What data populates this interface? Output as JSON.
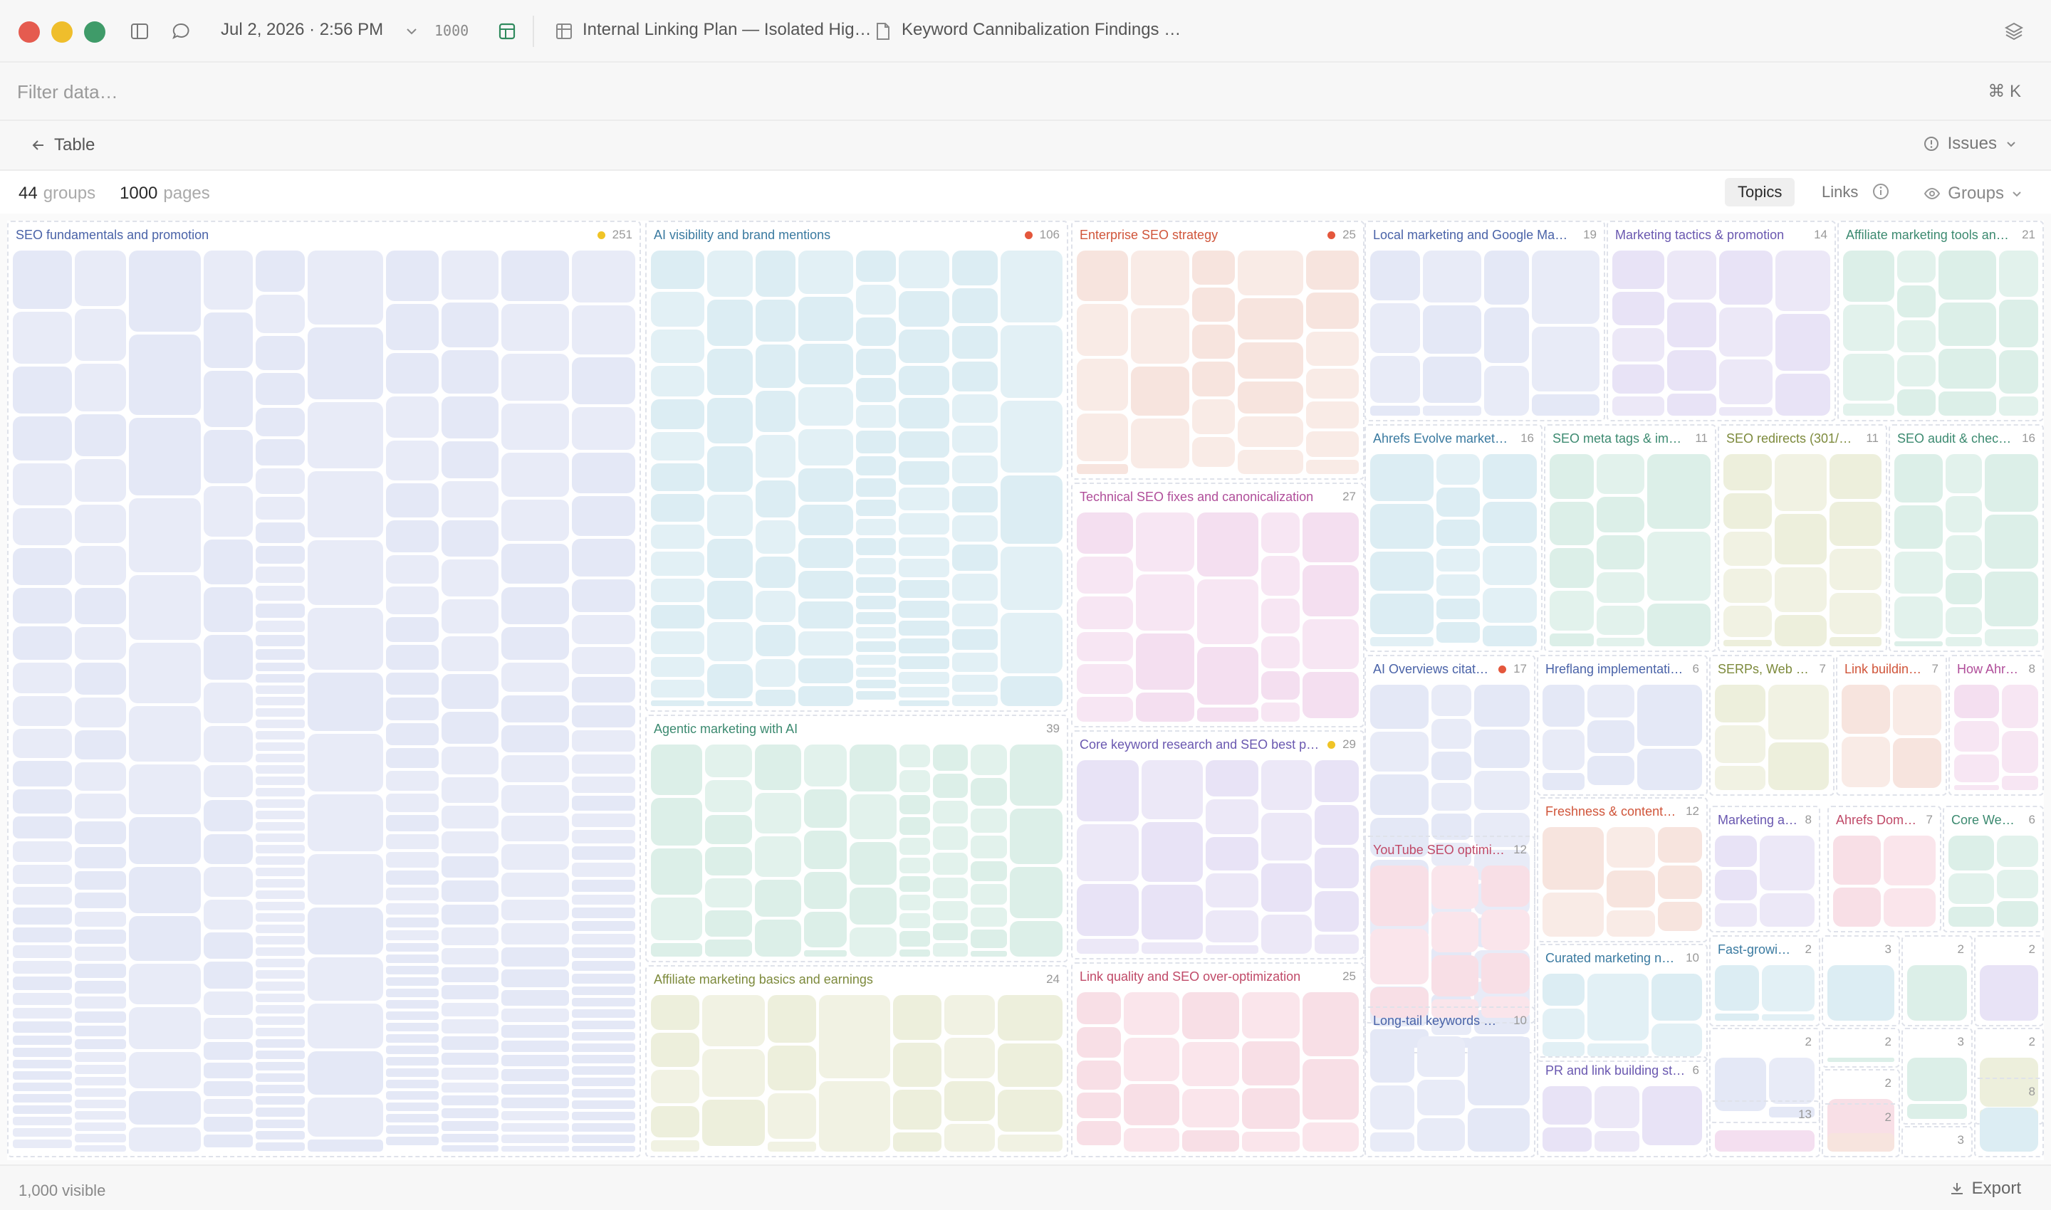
{
  "titlebar": {
    "datetime": "Jul 2, 2026 · 2:56 PM",
    "count": "1000",
    "tab1": "Internal Linking Plan — Isolated Hig…",
    "tab2": "Keyword Cannibalization Findings …"
  },
  "filter": {
    "placeholder": "Filter data…",
    "shortcut": "⌘ K"
  },
  "nav": {
    "back_label": "Table",
    "issues_label": "Issues"
  },
  "stats": {
    "groups_value": "44",
    "groups_label": "groups",
    "pages_value": "1000",
    "pages_label": "pages"
  },
  "view": {
    "topics": "Topics",
    "links": "Links",
    "groups": "Groups"
  },
  "footer": {
    "visible": "1,000 visible",
    "export": "Export"
  },
  "colors": {
    "blue": "#e6eaf6",
    "cyan": "#dfeef4",
    "peach": "#f8e6e1",
    "pink": "#f6e2f1",
    "lavender": "#ebe6f6",
    "rose": "#f9e1e8",
    "mint": "#def0ea",
    "olive": "#eef0df",
    "red": "#e4573c",
    "yellow": "#f0c426"
  },
  "groups": [
    {
      "name": "SEO fundamentals and promotion",
      "count": "251",
      "dot": "yellow",
      "color": "blue",
      "text": "#4a63a8"
    },
    {
      "name": "AI visibility and brand mentions",
      "count": "106",
      "dot": "red",
      "color": "cyan",
      "text": "#3a7aa0"
    },
    {
      "name": "Agentic marketing with AI",
      "count": "39",
      "color": "mint",
      "text": "#3c8a70"
    },
    {
      "name": "Affiliate marketing basics and earnings",
      "count": "24",
      "color": "olive",
      "text": "#7d8a3c"
    },
    {
      "name": "Enterprise SEO strategy",
      "count": "25",
      "dot": "red",
      "color": "peach",
      "text": "#d0553a"
    },
    {
      "name": "Technical SEO fixes and canonicalization",
      "count": "27",
      "color": "pink",
      "text": "#b04e9a"
    },
    {
      "name": "Core keyword research and SEO best p…",
      "count": "29",
      "dot": "yellow",
      "color": "lavender",
      "text": "#6a58b0"
    },
    {
      "name": "Link quality and SEO over-optimization",
      "count": "25",
      "color": "rose",
      "text": "#c04a68"
    },
    {
      "name": "Local marketing and Google Ma…",
      "count": "19",
      "color": "blue",
      "text": "#4a63a8"
    },
    {
      "name": "Marketing tactics & promotion",
      "count": "14",
      "color": "lavender",
      "text": "#6a58b0"
    },
    {
      "name": "Affiliate marketing tools and…",
      "count": "21",
      "color": "mint",
      "text": "#3c8a70"
    },
    {
      "name": "Ahrefs Evolve market…",
      "count": "16",
      "color": "cyan",
      "text": "#3a7aa0"
    },
    {
      "name": "SEO meta tags & im…",
      "count": "11",
      "color": "mint",
      "text": "#3c8a70"
    },
    {
      "name": "SEO redirects (301/…",
      "count": "11",
      "color": "olive",
      "text": "#7d8a3c"
    },
    {
      "name": "SEO audit & checkli…",
      "count": "16",
      "color": "mint",
      "text": "#3c8a70"
    },
    {
      "name": "AI Overviews citat…",
      "count": "17",
      "dot": "red",
      "color": "blue",
      "text": "#4a63a8"
    },
    {
      "name": "Hreflang implementati…",
      "count": "6",
      "color": "blue",
      "text": "#4a63a8"
    },
    {
      "name": "SERPs, Web …",
      "count": "7",
      "color": "olive",
      "text": "#7d8a3c"
    },
    {
      "name": "Link buildin…",
      "count": "7",
      "color": "peach",
      "text": "#d0553a"
    },
    {
      "name": "How Ahref…",
      "count": "8",
      "color": "pink",
      "text": "#b04e9a"
    },
    {
      "name": "Freshness & content …",
      "count": "12",
      "color": "peach",
      "text": "#d0553a"
    },
    {
      "name": "Marketing a…",
      "count": "8",
      "color": "lavender",
      "text": "#6a58b0"
    },
    {
      "name": "Ahrefs Dom…",
      "count": "7",
      "color": "rose",
      "text": "#c04a68"
    },
    {
      "name": "Core Web V…",
      "count": "6",
      "color": "mint",
      "text": "#3c8a70"
    },
    {
      "name": "YouTube SEO optimi…",
      "count": "12",
      "color": "rose",
      "text": "#c04a68"
    },
    {
      "name": "Curated marketing n…",
      "count": "10",
      "color": "cyan",
      "text": "#3a7aa0"
    },
    {
      "name": "Fast-growi…",
      "count": "2",
      "color": "cyan",
      "text": "#3a7aa0"
    },
    {
      "name": "",
      "count": "3",
      "color": "cyan",
      "text": "#3a7aa0"
    },
    {
      "name": "",
      "count": "2",
      "color": "mint",
      "text": "#3c8a70"
    },
    {
      "name": "",
      "count": "2",
      "color": "lavender",
      "text": "#6a58b0"
    },
    {
      "name": "Long-tail keywords …",
      "count": "10",
      "color": "blue",
      "text": "#4a63a8"
    },
    {
      "name": "PR and link building st…",
      "count": "6",
      "color": "lavender",
      "text": "#6a58b0"
    },
    {
      "name": "",
      "count": "2",
      "color": "blue",
      "text": "#4a63a8"
    },
    {
      "name": "",
      "count": "2",
      "color": "mint",
      "text": "#3c8a70"
    },
    {
      "name": "",
      "count": "3",
      "color": "mint",
      "text": "#3c8a70"
    },
    {
      "name": "",
      "count": "2",
      "color": "olive",
      "text": "#7d8a3c"
    },
    {
      "name": "",
      "count": "2",
      "color": "rose",
      "text": "#c04a68"
    },
    {
      "name": "",
      "count": "8",
      "color": "cyan",
      "text": "#3a7aa0"
    },
    {
      "name": "",
      "count": "13",
      "color": "pink",
      "text": "#b04e9a"
    },
    {
      "name": "",
      "count": "2",
      "color": "peach",
      "text": "#d0553a"
    },
    {
      "name": "",
      "count": "3",
      "color": "lavender",
      "text": "#6a58b0"
    }
  ]
}
